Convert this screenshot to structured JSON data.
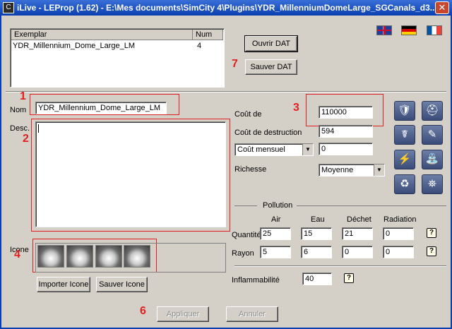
{
  "window": {
    "title": "iLive - LEProp (1.62) - E:\\Mes documents\\SimCity 4\\Plugins\\YDR_MillenniumDomeLarge_SGCanals_d3...",
    "close_glyph": "✕"
  },
  "list": {
    "headers": {
      "col1": "Exemplar",
      "col2": "Num"
    },
    "rows": [
      {
        "name": "YDR_Millennium_Dome_Large_LM",
        "num": "4"
      }
    ]
  },
  "buttons": {
    "open_dat": "Ouvrir DAT",
    "save_dat": "Sauver DAT",
    "import_icon": "Importer Icone",
    "save_icon": "Sauver Icone",
    "apply": "Appliquer",
    "cancel": "Annuler"
  },
  "labels": {
    "nom": "Nom",
    "desc": "Desc.",
    "icone": "Icone",
    "cout": "Coût de",
    "cout_destruction": "Coût de destruction",
    "richesse": "Richesse",
    "pollution": "Pollution",
    "air": "Air",
    "eau": "Eau",
    "dechet": "Déchet",
    "radiation": "Radiation",
    "quantite": "Quantité",
    "rayon": "Rayon",
    "inflammabilite": "Inflammabilité"
  },
  "fields": {
    "nom": "YDR_Millennium_Dome_Large_LM",
    "description": "",
    "cout": "110000",
    "cout_destruction": "594",
    "cout_mensuel_select": "Coût mensuel",
    "cout_mensuel": "0",
    "richesse": "Moyenne",
    "quantite": {
      "air": "25",
      "eau": "15",
      "dechet": "21",
      "radiation": "0"
    },
    "rayon": {
      "air": "5",
      "eau": "6",
      "dechet": "0",
      "radiation": "0"
    },
    "inflammabilite": "40"
  },
  "annotations": [
    "1",
    "2",
    "3",
    "4",
    "6",
    "7"
  ],
  "help_glyph": "?",
  "icon_glyphs": {
    "police": "🛡",
    "fire": "⛑",
    "health": "☤",
    "school": "✎",
    "power": "⚡",
    "water": "⛲",
    "garbage": "♻",
    "transport": "⛯"
  },
  "colors": {
    "title_bar": "#0a3fb0",
    "annotation_red": "#e02020",
    "icon_button": "#4a5c88"
  }
}
